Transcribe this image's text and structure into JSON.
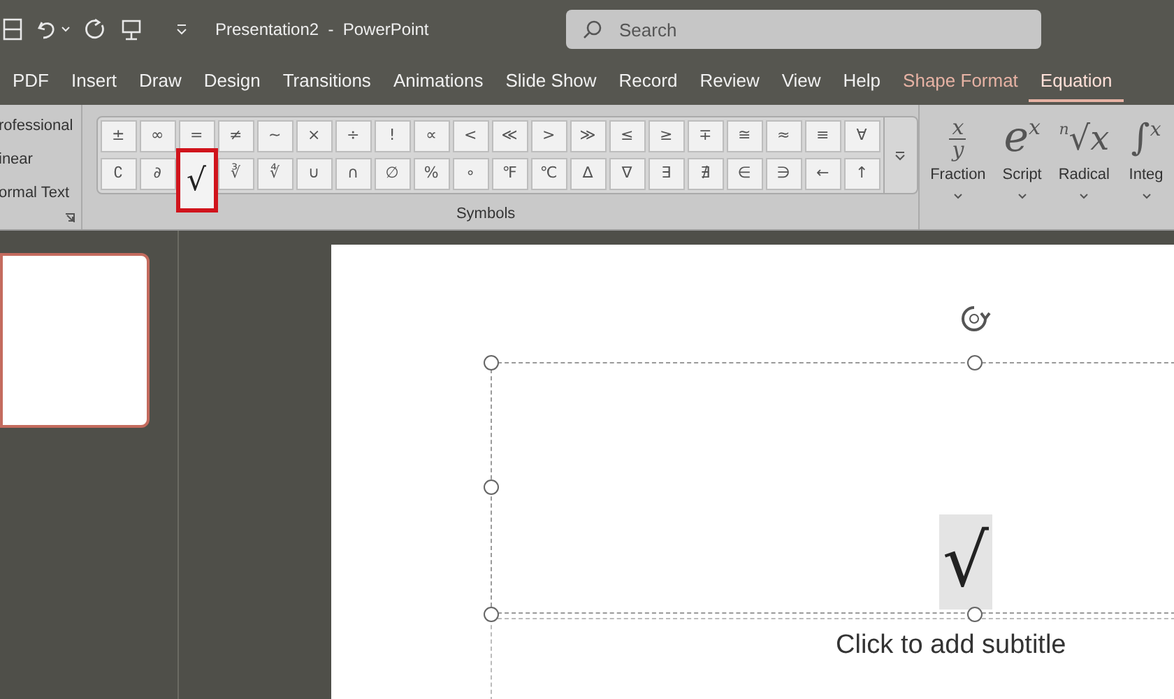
{
  "title_bar": {
    "title": "Presentation2  -  PowerPoint",
    "search": {
      "placeholder": "Search"
    }
  },
  "tabs": [
    {
      "label": "PDF",
      "selected": false,
      "kind": "normal"
    },
    {
      "label": "Insert",
      "selected": false,
      "kind": "normal"
    },
    {
      "label": "Draw",
      "selected": false,
      "kind": "normal"
    },
    {
      "label": "Design",
      "selected": false,
      "kind": "normal"
    },
    {
      "label": "Transitions",
      "selected": false,
      "kind": "normal"
    },
    {
      "label": "Animations",
      "selected": false,
      "kind": "normal"
    },
    {
      "label": "Slide Show",
      "selected": false,
      "kind": "normal"
    },
    {
      "label": "Record",
      "selected": false,
      "kind": "normal"
    },
    {
      "label": "Review",
      "selected": false,
      "kind": "normal"
    },
    {
      "label": "View",
      "selected": false,
      "kind": "normal"
    },
    {
      "label": "Help",
      "selected": false,
      "kind": "normal"
    },
    {
      "label": "Shape Format",
      "selected": false,
      "kind": "contextual"
    },
    {
      "label": "Equation",
      "selected": true,
      "kind": "contextual"
    }
  ],
  "ribbon": {
    "format_options": [
      "rofessional",
      "inear",
      "ormal Text"
    ],
    "symbols": {
      "label": "Symbols",
      "rows": [
        [
          {
            "symbol": "±",
            "selected": false
          },
          {
            "symbol": "∞",
            "selected": false
          },
          {
            "symbol": "=",
            "selected": false
          },
          {
            "symbol": "≠",
            "selected": false
          },
          {
            "symbol": "~",
            "selected": false
          },
          {
            "symbol": "×",
            "selected": false
          },
          {
            "symbol": "÷",
            "selected": false
          },
          {
            "symbol": "!",
            "selected": false
          },
          {
            "symbol": "∝",
            "selected": false
          },
          {
            "symbol": "<",
            "selected": false
          },
          {
            "symbol": "≪",
            "selected": false
          },
          {
            "symbol": ">",
            "selected": false
          },
          {
            "symbol": "≫",
            "selected": false
          },
          {
            "symbol": "≤",
            "selected": false
          },
          {
            "symbol": "≥",
            "selected": false
          },
          {
            "symbol": "∓",
            "selected": false
          },
          {
            "symbol": "≅",
            "selected": false
          },
          {
            "symbol": "≈",
            "selected": false
          },
          {
            "symbol": "≡",
            "selected": false
          },
          {
            "symbol": "∀",
            "selected": false
          }
        ],
        [
          {
            "symbol": "∁",
            "selected": false
          },
          {
            "symbol": "∂",
            "selected": false
          },
          {
            "symbol": "√",
            "selected": true
          },
          {
            "symbol": "∛",
            "selected": false
          },
          {
            "symbol": "∜",
            "selected": false
          },
          {
            "symbol": "∪",
            "selected": false
          },
          {
            "symbol": "∩",
            "selected": false
          },
          {
            "symbol": "∅",
            "selected": false
          },
          {
            "symbol": "%",
            "selected": false
          },
          {
            "symbol": "∘",
            "selected": false
          },
          {
            "symbol": "℉",
            "selected": false
          },
          {
            "symbol": "℃",
            "selected": false
          },
          {
            "symbol": "∆",
            "selected": false
          },
          {
            "symbol": "∇",
            "selected": false
          },
          {
            "symbol": "∃",
            "selected": false
          },
          {
            "symbol": "∄",
            "selected": false
          },
          {
            "symbol": "∈",
            "selected": false
          },
          {
            "symbol": "∋",
            "selected": false
          },
          {
            "symbol": "←",
            "selected": false
          },
          {
            "symbol": "↑",
            "selected": false
          }
        ]
      ]
    },
    "structures": [
      {
        "kind": "fraction",
        "label": "Fraction",
        "top": "x",
        "bottom": "y"
      },
      {
        "kind": "script",
        "label": "Script",
        "base": "e",
        "sup": "x"
      },
      {
        "kind": "radical",
        "label": "Radical",
        "index": "n",
        "base": "√x"
      },
      {
        "kind": "integral",
        "label": "Integ",
        "base": "∫",
        "sup": "x"
      }
    ]
  },
  "slides": [
    {
      "selected": true
    }
  ],
  "slide": {
    "equation": "√",
    "subtitle": "Click to add subtitle"
  }
}
